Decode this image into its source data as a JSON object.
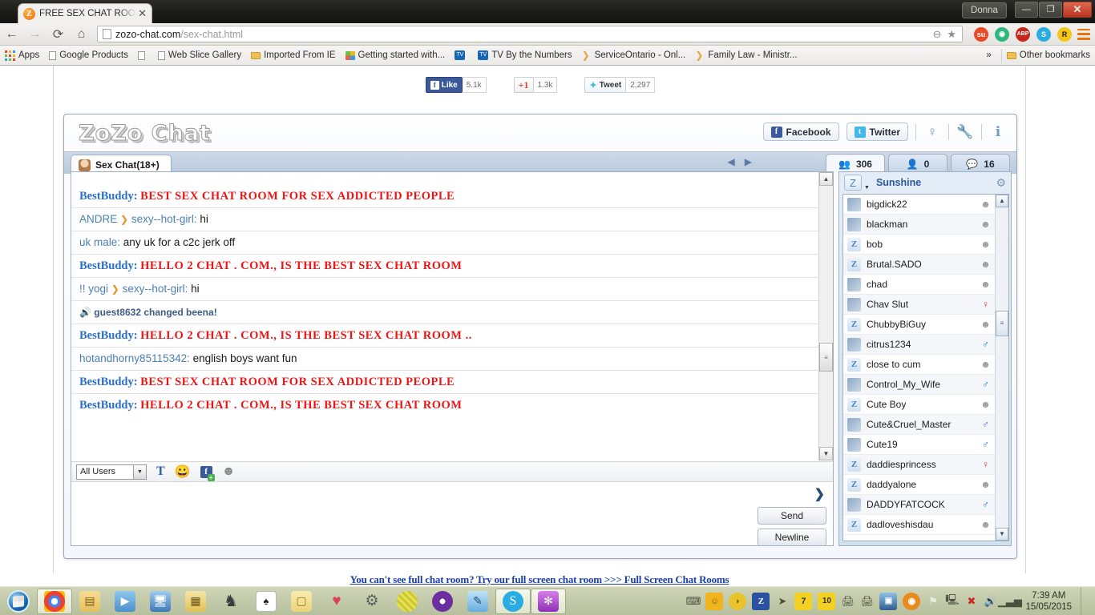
{
  "window": {
    "user_button": "Donna",
    "minimize": "—",
    "maximize": "❐",
    "close": "✕"
  },
  "browser": {
    "tab_title": "FREE SEX CHAT ROOM an",
    "tab_close": "✕",
    "favicon": "Z",
    "back_icon": "←",
    "forward_icon": "→",
    "reload_icon": "⟳",
    "home_icon": "⌂",
    "url_host": "zozo-chat.com",
    "url_path": "/sex-chat.html",
    "zoom_icon": "⊖",
    "star_icon": "★",
    "extensions": [
      {
        "name": "stumbleupon-icon",
        "glyph": "su",
        "color": "#eb4924"
      },
      {
        "name": "avira-icon",
        "glyph": "◉",
        "color": "#2eb67d"
      },
      {
        "name": "adblock-plus-icon",
        "glyph": "ABP",
        "color": "#c8251a"
      },
      {
        "name": "skype-icon",
        "glyph": "S",
        "color": "#2aabe2"
      },
      {
        "name": "roboform-icon",
        "glyph": "R",
        "color": "#f5c518"
      }
    ],
    "menu_icon": "hamburger"
  },
  "bookmarks": {
    "apps_label": "Apps",
    "items": [
      {
        "label": "Google Products",
        "icon": "doc-icon"
      },
      {
        "label": "",
        "icon": "doc-icon"
      },
      {
        "label": "Web Slice Gallery",
        "icon": "doc-icon"
      },
      {
        "label": "Imported From IE",
        "icon": "folder-icon"
      },
      {
        "label": "Getting started with...",
        "icon": "windows-flag-icon"
      },
      {
        "label": "",
        "icon": "tv-icon"
      },
      {
        "label": "TV By the Numbers",
        "icon": "tv-icon"
      },
      {
        "label": "ServiceOntario - Onl...",
        "icon": "serviceontario-icon"
      },
      {
        "label": "Family Law - Ministr...",
        "icon": "serviceontario-icon"
      }
    ],
    "overflow": "»",
    "other_bookmarks": "Other bookmarks"
  },
  "social": {
    "facebook": {
      "label": "Like",
      "count": "5.1k",
      "mark": "f"
    },
    "google": {
      "label": "+1",
      "count": "1.3k",
      "g": "g"
    },
    "twitter": {
      "label": "Tweet",
      "count": "2,297",
      "bird": "❥"
    }
  },
  "app": {
    "logo": "ZoZo Chat",
    "header_buttons": [
      {
        "label": "Facebook",
        "mark": "f",
        "color": "#3b5998"
      },
      {
        "label": "Twitter",
        "mark": "t",
        "color": "#41b7ec"
      }
    ],
    "header_icons": [
      {
        "name": "webcam-icon",
        "glyph": "♀"
      },
      {
        "name": "settings-wrench-icon",
        "glyph": "🔧"
      },
      {
        "name": "info-icon",
        "glyph": "ℹ"
      }
    ],
    "chat_tab": "Sex Chat(18+)",
    "tab_nav_prev": "◀",
    "tab_nav_next": "▶",
    "panel_tabs": [
      {
        "name": "users-tab",
        "icon": "users-icon",
        "count": "306",
        "active": true
      },
      {
        "name": "friends-tab",
        "icon": "add-friend-icon",
        "count": "0",
        "active": false
      },
      {
        "name": "messages-tab",
        "icon": "speech-bubble-icon",
        "count": "16",
        "active": false
      }
    ],
    "me": {
      "name": "Sunshine",
      "avatar": "Z",
      "gear": "⚙"
    },
    "messages": [
      {
        "type": "shout",
        "nick": "BestBuddy:",
        "text": "BEST    SEX    CHAT    ROOM    FOR    SEX   ADDICTED   PEOPLE"
      },
      {
        "type": "pm",
        "nick": "ANDRE",
        "arrow": "❯",
        "target": "sexy--hot-girl:",
        "text": "hi"
      },
      {
        "type": "normal",
        "nick": "uk male:",
        "text": "any uk for a c2c jerk off"
      },
      {
        "type": "shout",
        "nick": "BestBuddy:",
        "text": "HELLO  2   CHAT .     COM.,   IS   THE    BEST   SEX   CHAT    ROOM"
      },
      {
        "type": "pm",
        "nick": "!! yogi",
        "arrow": "❯",
        "target": "sexy--hot-girl:",
        "text": "hi"
      },
      {
        "type": "system",
        "icon": "speaker-icon",
        "text": "guest8632 changed beena!"
      },
      {
        "type": "shout",
        "nick": "BestBuddy:",
        "text": "HELLO  2   CHAT .     COM.,   IS   THE    BEST   SEX   CHAT    ROOM .."
      },
      {
        "type": "normal",
        "nick": "hotandhorny85115342:",
        "text": "english boys want fun"
      },
      {
        "type": "shout",
        "nick": "BestBuddy:",
        "text": "BEST    SEX    CHAT    ROOM    FOR    SEX   ADDICTED   PEOPLE"
      },
      {
        "type": "shout",
        "nick": "BestBuddy:",
        "text": "HELLO  2   CHAT .     COM.,   IS   THE   BEST   SEX   CHAT    ROOM"
      }
    ],
    "composer": {
      "recipient_value": "All Users",
      "recipient_caret": "▼",
      "text_tool": "T",
      "emoji_tool": "☺",
      "facebook_tool": "f",
      "avatar_tool": "☻",
      "input_value": "",
      "expand_caret": "❯",
      "send_label": "Send",
      "newline_label": "Newline"
    },
    "scroll": {
      "up": "▲",
      "down": "▼",
      "grip": "≡"
    },
    "users": [
      {
        "name": "bigdick22",
        "avatar": "photo",
        "status": "unknown"
      },
      {
        "name": "blackman",
        "avatar": "photo",
        "status": "unknown"
      },
      {
        "name": "bob",
        "avatar": "default",
        "status": "unknown"
      },
      {
        "name": "Brutal.SADO",
        "avatar": "default",
        "status": "unknown"
      },
      {
        "name": "chad",
        "avatar": "photo",
        "status": "unknown"
      },
      {
        "name": "Chav Slut",
        "avatar": "photo",
        "status": "female"
      },
      {
        "name": "ChubbyBiGuy",
        "avatar": "default",
        "status": "unknown"
      },
      {
        "name": "citrus1234",
        "avatar": "photo",
        "status": "male"
      },
      {
        "name": "close to cum",
        "avatar": "default",
        "status": "unknown"
      },
      {
        "name": "Control_My_Wife",
        "avatar": "photo",
        "status": "male"
      },
      {
        "name": "Cute Boy",
        "avatar": "default",
        "status": "unknown"
      },
      {
        "name": "Cute&Cruel_Master",
        "avatar": "photo",
        "status": "male"
      },
      {
        "name": "Cute19",
        "avatar": "photo",
        "status": "male"
      },
      {
        "name": "daddiesprincess",
        "avatar": "default",
        "status": "female"
      },
      {
        "name": "daddyalone",
        "avatar": "default",
        "status": "unknown"
      },
      {
        "name": "DADDYFATCOCK",
        "avatar": "photo",
        "status": "male"
      },
      {
        "name": "dadloveshisdau",
        "avatar": "default",
        "status": "unknown"
      }
    ],
    "footer_link": "You can't see full chat room? Try our full screen chat room  >>> Full Screen Chat Rooms"
  },
  "taskbar": {
    "start": "windows-orb",
    "items": [
      {
        "name": "chrome-taskbar-icon",
        "glyph": "◉",
        "color": "#4285f4",
        "active": true
      },
      {
        "name": "explorer-taskbar-icon",
        "glyph": "📁",
        "color": "#f0c45a",
        "active": false
      },
      {
        "name": "media-player-taskbar-icon",
        "glyph": "▶",
        "color": "#e8821c",
        "active": false
      },
      {
        "name": "remote-assist-taskbar-icon",
        "glyph": "🖥",
        "color": "#5b9bd5",
        "active": false
      },
      {
        "name": "calculator-taskbar-icon",
        "glyph": "▤",
        "color": "#e8b41c",
        "active": false
      },
      {
        "name": "chess-taskbar-icon",
        "glyph": "♞",
        "color": "#3c3c3c",
        "active": false
      },
      {
        "name": "solitaire-taskbar-icon",
        "glyph": "♠",
        "color": "#ffffff",
        "active": false
      },
      {
        "name": "sticky-notes-taskbar-icon",
        "glyph": "▢",
        "color": "#f5d76e",
        "active": false
      },
      {
        "name": "heart-app-taskbar-icon",
        "glyph": "♥",
        "color": "#d9425a",
        "active": false
      },
      {
        "name": "gear-app-taskbar-icon",
        "glyph": "⚙",
        "color": "#6b6b6b",
        "active": false
      },
      {
        "name": "ball-app-taskbar-icon",
        "glyph": "◍",
        "color": "#d8d84a",
        "active": false
      },
      {
        "name": "disc-app-taskbar-icon",
        "glyph": "◎",
        "color": "#8a2be2",
        "active": false
      },
      {
        "name": "paint-taskbar-icon",
        "glyph": "🎨",
        "color": "#5bb3e0",
        "active": false
      },
      {
        "name": "skype-taskbar-icon",
        "glyph": "S",
        "color": "#2aabe2",
        "active": true
      },
      {
        "name": "chat-app-taskbar-icon",
        "glyph": "✻",
        "color": "#b14ec8",
        "active": true
      }
    ],
    "tray": [
      {
        "name": "keyboard-tray-icon",
        "glyph": "⌨",
        "color": "#6b705c"
      },
      {
        "name": "emoji-tray-icon",
        "glyph": "☺",
        "color": "#f0b41e"
      },
      {
        "name": "lemon-tray-icon",
        "glyph": "◗",
        "color": "#e8c32c"
      },
      {
        "name": "zozo-tray-icon",
        "glyph": "Z",
        "color": "#2a52a0"
      },
      {
        "name": "mouse-tray-icon",
        "glyph": "➤",
        "color": "#7a8470"
      },
      {
        "name": "note7-tray-icon",
        "glyph": "7",
        "color": "#f2d024"
      },
      {
        "name": "note10-tray-icon",
        "glyph": "10",
        "color": "#f2d024"
      },
      {
        "name": "printer1-tray-icon",
        "glyph": "🖨",
        "color": "#9aa08c"
      },
      {
        "name": "printer2-tray-icon",
        "glyph": "🖨",
        "color": "#9aa08c"
      },
      {
        "name": "display-tray-icon",
        "glyph": "🖵",
        "color": "#3d6fa0"
      },
      {
        "name": "avira-tray-icon",
        "glyph": "◉",
        "color": "#e88a1c"
      },
      {
        "name": "flag-tray-icon",
        "glyph": "⚑",
        "color": "#d0d4c0"
      },
      {
        "name": "network-monitor-tray-icon",
        "glyph": "🖳",
        "color": "#5a6050"
      },
      {
        "name": "network-error-tray-icon",
        "glyph": "✖",
        "color": "#cc2a2a"
      },
      {
        "name": "volume-tray-icon",
        "glyph": "🔊",
        "color": "#49503c"
      },
      {
        "name": "signal-tray-icon",
        "glyph": "▮",
        "color": "#49503c"
      }
    ],
    "clock_time": "7:39 AM",
    "clock_date": "15/05/2015"
  }
}
